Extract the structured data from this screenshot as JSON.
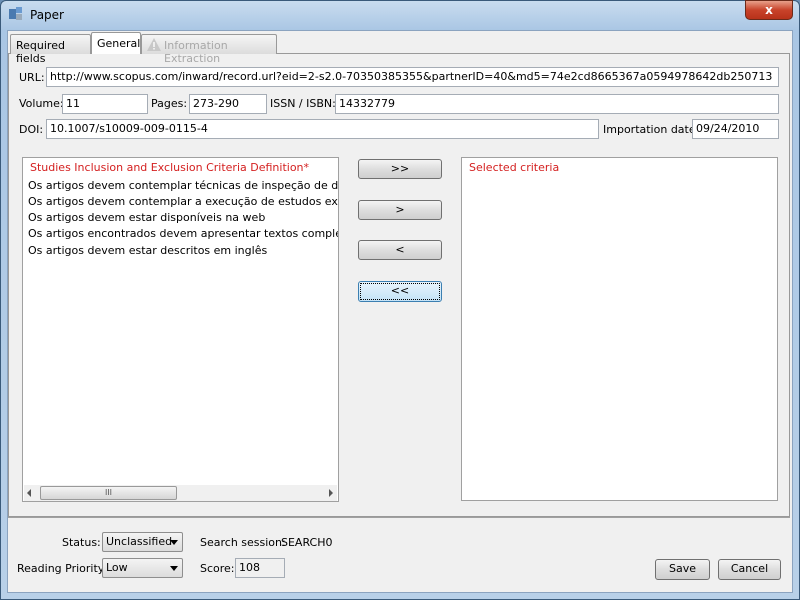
{
  "window": {
    "title": "Paper",
    "close_label": "x"
  },
  "tabs": [
    {
      "label": "Required fields"
    },
    {
      "label": "General"
    },
    {
      "label": "Information Extraction",
      "icon": "warning-icon"
    }
  ],
  "fields": {
    "url_label": "URL:",
    "url": "http://www.scopus.com/inward/record.url?eid=2-s2.0-70350385355&partnerID=40&md5=74e2cd8665367a0594978642db250713",
    "volume_label": "Volume:",
    "volume": "11",
    "pages_label": "Pages:",
    "pages": "273-290",
    "issn_label": "ISSN / ISBN:",
    "issn": "14332779",
    "doi_label": "DOI:",
    "doi": "10.1007/s10009-009-0115-4",
    "importation_label": "Importation date:",
    "importation": "09/24/2010"
  },
  "criteria": {
    "title": "Studies Inclusion and Exclusion Criteria Definition*",
    "items": [
      "Os artigos devem contemplar técnicas de inspeção de documentos",
      "Os artigos devem contemplar a execução de estudos experimentais",
      "Os artigos devem estar disponíveis na web",
      "Os artigos encontrados devem apresentar textos completos dos",
      "Os artigos devem estar descritos em inglês"
    ],
    "scroll_grip": "III"
  },
  "buttons": {
    "add_all": ">>",
    "add": ">",
    "remove": "<",
    "remove_all": "<<",
    "save": "Save",
    "cancel": "Cancel"
  },
  "selected": {
    "title": "Selected criteria"
  },
  "footer": {
    "status_label": "Status:",
    "status": "Unclassified",
    "search_session_label": "Search session:",
    "search_session": "SEARCH0",
    "priority_label": "Reading Priority:",
    "priority": "Low",
    "score_label": "Score:",
    "score": "108"
  },
  "colors": {
    "criteria_title": "#d42020"
  }
}
